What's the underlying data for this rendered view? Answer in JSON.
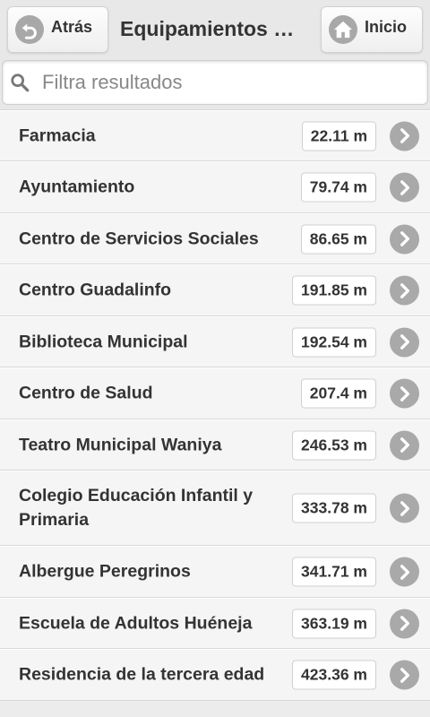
{
  "header": {
    "back_label": "Atrás",
    "title": "Equipamientos …",
    "home_label": "Inicio",
    "back_icon": "undo-arrow-icon",
    "home_icon": "home-icon"
  },
  "search": {
    "placeholder": "Filtra resultados",
    "value": "",
    "icon": "search-icon"
  },
  "items": [
    {
      "name": "Farmacia",
      "distance": "22.11 m"
    },
    {
      "name": "Ayuntamiento",
      "distance": "79.74 m"
    },
    {
      "name": "Centro de Servicios Sociales",
      "distance": "86.65 m"
    },
    {
      "name": "Centro Guadalinfo",
      "distance": "191.85 m"
    },
    {
      "name": "Biblioteca Municipal",
      "distance": "192.54 m"
    },
    {
      "name": "Centro de Salud",
      "distance": "207.4 m"
    },
    {
      "name": "Teatro Municipal Waniya",
      "distance": "246.53 m"
    },
    {
      "name": "Colegio Educación Infantil y Primaria",
      "distance": "333.78 m"
    },
    {
      "name": "Albergue Peregrinos",
      "distance": "341.71 m"
    },
    {
      "name": "Escuela de Adultos Huéneja",
      "distance": "363.19 m"
    },
    {
      "name": "Residencia de la tercera edad",
      "distance": "423.36 m"
    }
  ],
  "colors": {
    "background": "#ececec",
    "row": "#f5f5f5",
    "icon_circle": "#a9a9a9",
    "text": "#333333"
  }
}
